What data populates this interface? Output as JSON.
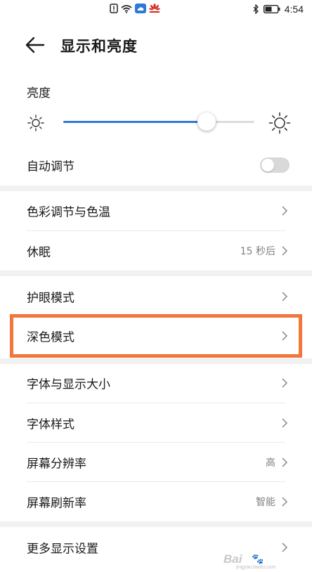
{
  "status_bar": {
    "time": "4:54",
    "icons": [
      "notification-icon",
      "wifi-icon",
      "cloud-icon",
      "huawei-icon",
      "bluetooth-icon",
      "battery-icon"
    ]
  },
  "header": {
    "title": "显示和亮度"
  },
  "brightness": {
    "label": "亮度",
    "level_percent": 75,
    "accent_color": "#2f7ad6"
  },
  "auto_adjust": {
    "label": "自动调节",
    "enabled": false
  },
  "rows": {
    "color_temp": {
      "label": "色彩调节与色温"
    },
    "sleep": {
      "label": "休眠",
      "value": "15 秒后"
    },
    "eye_comfort": {
      "label": "护眼模式"
    },
    "dark_mode": {
      "label": "深色模式"
    },
    "font_size": {
      "label": "字体与显示大小"
    },
    "font_style": {
      "label": "字体样式"
    },
    "resolution": {
      "label": "屏幕分辨率",
      "value": "高"
    },
    "refresh_rate": {
      "label": "屏幕刷新率",
      "value": "智能"
    },
    "more_display": {
      "label": "更多显示设置"
    }
  },
  "highlight_color": "#f2753b",
  "watermark": {
    "text": "Bai",
    "sub": "jingyan.baidu.com"
  }
}
